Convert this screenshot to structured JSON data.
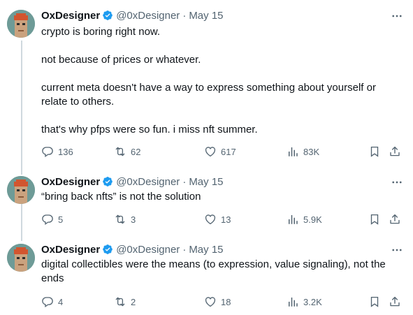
{
  "tweets": [
    {
      "name": "OxDesigner",
      "handle": "@0xDesigner",
      "separator": "·",
      "date": "May 15",
      "text": "crypto is boring right now.\n\nnot because of prices or whatever.\n\ncurrent meta doesn't have a way to express something about yourself or\nrelate to others.\n\nthat's why pfps were so fun. i miss nft summer.",
      "replies": "136",
      "retweets": "62",
      "likes": "617",
      "views": "83K"
    },
    {
      "name": "OxDesigner",
      "handle": "@0xDesigner",
      "separator": "·",
      "date": "May 15",
      "text": "“bring back nfts” is not the solution",
      "replies": "5",
      "retweets": "3",
      "likes": "13",
      "views": "5.9K"
    },
    {
      "name": "OxDesigner",
      "handle": "@0xDesigner",
      "separator": "·",
      "date": "May 15",
      "text": "digital collectibles were the means (to expression, value signaling), not the\nends",
      "replies": "4",
      "retweets": "2",
      "likes": "18",
      "views": "3.2K"
    }
  ],
  "colors": {
    "verified": "#1d9bf0",
    "muted": "#536471",
    "thread_line": "#cfd9de",
    "avatar_bg": "#6e9b97",
    "avatar_hat": "#d2552f"
  },
  "icons": [
    "verified-badge-icon",
    "more-icon",
    "reply-icon",
    "retweet-icon",
    "like-icon",
    "views-icon",
    "bookmark-icon",
    "share-icon"
  ]
}
